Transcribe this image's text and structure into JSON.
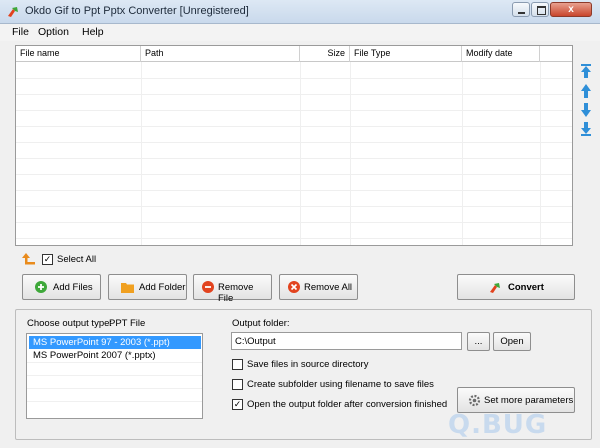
{
  "window": {
    "title": "Okdo Gif to Ppt Pptx Converter [Unregistered]",
    "close_glyph": "x"
  },
  "menu": {
    "items": [
      "File",
      "Option",
      "Help"
    ]
  },
  "file_list": {
    "columns": [
      "File name",
      "Path",
      "Size",
      "File Type",
      "Modify date"
    ],
    "rows": []
  },
  "select_all": {
    "label": "Select All",
    "checked": true
  },
  "buttons": {
    "add_files": "Add Files",
    "add_folder": "Add Folder",
    "remove_file": "Remove File",
    "remove_all": "Remove All",
    "convert": "Convert"
  },
  "output_type": {
    "label": "Choose output type:",
    "current": "PPT File",
    "options": [
      "MS PowerPoint 97 - 2003 (*.ppt)",
      "MS PowerPoint 2007 (*.pptx)"
    ],
    "selected_index": 0
  },
  "output_folder": {
    "label": "Output folder:",
    "value": "C:\\Output",
    "browse_label": "...",
    "open_label": "Open"
  },
  "options": {
    "save_in_source": {
      "label": "Save files in source directory",
      "checked": false
    },
    "create_subfolder": {
      "label": "Create subfolder using filename to save files",
      "checked": false
    },
    "open_after": {
      "label": "Open the output folder after conversion finished",
      "checked": true
    }
  },
  "set_params_label": "Set more parameters",
  "watermark": "Q.BUG",
  "icons": {
    "app": "app-logo-icon",
    "move_top": "move-top-icon",
    "move_up": "move-up-icon",
    "move_down": "move-down-icon",
    "move_bottom": "move-bottom-icon",
    "select_up": "select-up-arrow-icon",
    "add_files": "plus-circle-icon",
    "add_folder": "folder-icon",
    "remove_file": "minus-circle-icon",
    "remove_all": "x-circle-icon",
    "convert": "convert-icon",
    "settings": "gear-icon"
  },
  "colors": {
    "accent": "#3399ff",
    "arrow_blue": "#2f8fd8",
    "add_green": "#3ea83a",
    "folder_orange": "#f0a020",
    "remove_red": "#e2431e",
    "select_arrow_orange": "#e98b1c"
  }
}
